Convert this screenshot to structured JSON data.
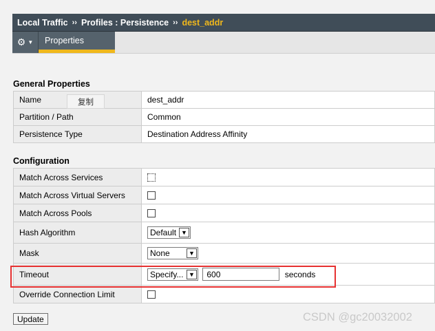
{
  "breadcrumb": {
    "part1": "Local Traffic",
    "separator": "››",
    "part2": "Profiles : Persistence",
    "current": "dest_addr"
  },
  "tabs": [
    {
      "label": "Properties",
      "active": true
    }
  ],
  "icons": {
    "settings": "gear-icon",
    "menu": "chevron-down-icon"
  },
  "colors": {
    "header_bg": "#404d58",
    "accent": "#f0b81c",
    "highlight": "#e63030"
  },
  "general": {
    "title": "General Properties",
    "copy_label": "复制",
    "rows": [
      {
        "label": "Name",
        "value": "dest_addr"
      },
      {
        "label": "Partition / Path",
        "value": "Common"
      },
      {
        "label": "Persistence Type",
        "value": "Destination Address Affinity"
      }
    ]
  },
  "configuration": {
    "title": "Configuration",
    "match_services": "Match Across Services",
    "match_virtual": "Match Across Virtual Servers",
    "match_pools": "Match Across Pools",
    "hash_label": "Hash Algorithm",
    "hash_value": "Default",
    "mask_label": "Mask",
    "mask_value": "None",
    "timeout_label": "Timeout",
    "timeout_mode": "Specify...",
    "timeout_value": "600",
    "timeout_unit": "seconds",
    "override_label": "Override Connection Limit"
  },
  "update_label": "Update",
  "watermark": "CSDN @gc20032002"
}
